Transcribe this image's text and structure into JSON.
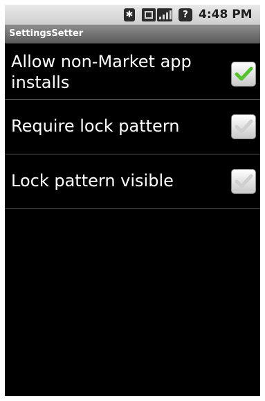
{
  "status_bar": {
    "time": "4:48 PM",
    "icons": [
      "bluetooth-icon",
      "data-icon",
      "signal-icon",
      "battery-icon"
    ],
    "bluetooth_glyph": "✱",
    "battery_glyph": "?"
  },
  "title_bar": {
    "title": "SettingsSetter"
  },
  "preferences": [
    {
      "label": "Allow non-Market app installs",
      "checked": true
    },
    {
      "label": "Require lock pattern",
      "checked": false
    },
    {
      "label": "Lock pattern visible",
      "checked": false
    }
  ],
  "colors": {
    "background": "#000000",
    "check_on": "#56c230",
    "check_off": "#d0d0d0",
    "divider": "#555555"
  }
}
